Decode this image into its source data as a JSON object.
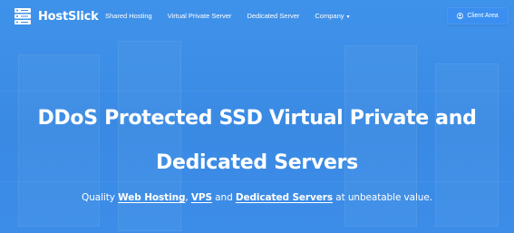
{
  "brand": {
    "name": "HostSlick",
    "icon": "server-stack-icon"
  },
  "nav": {
    "items": [
      {
        "label": "Shared Hosting"
      },
      {
        "label": "Virtual Private Server"
      },
      {
        "label": "Dedicated Server"
      },
      {
        "label": "Company"
      }
    ],
    "client_area_label": "Client Area",
    "client_area_icon": "user-circle-icon"
  },
  "hero": {
    "headline_line1": "DDoS Protected SSD Virtual Private and",
    "headline_line2": "Dedicated Servers",
    "tagline_prefix": "Quality ",
    "tagline_link1": "Web Hosting",
    "tagline_sep1": ", ",
    "tagline_link2": "VPS",
    "tagline_mid": " and ",
    "tagline_link3": "Dedicated Servers",
    "tagline_suffix": " at unbeatable value."
  },
  "colors": {
    "background": "#3d8ee6",
    "button": "#3b8ff0",
    "text": "#ffffff"
  }
}
